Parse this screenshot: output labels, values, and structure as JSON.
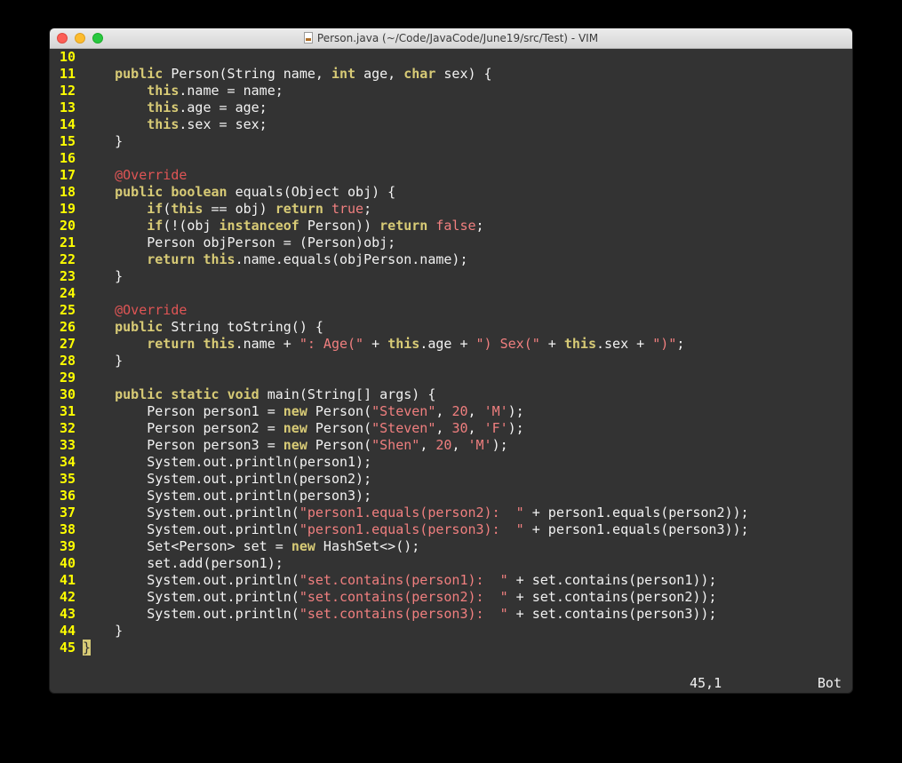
{
  "window": {
    "title": "Person.java (~/Code/JavaCode/June19/src/Test) - VIM",
    "file_icon": "java-file-icon"
  },
  "editor": {
    "lines": [
      {
        "num": "10",
        "tokens": []
      },
      {
        "num": "11",
        "tokens": [
          [
            "",
            "    "
          ],
          [
            "kw",
            "public"
          ],
          [
            "",
            " Person(String name, "
          ],
          [
            "kw",
            "int"
          ],
          [
            "",
            " age, "
          ],
          [
            "kw",
            "char"
          ],
          [
            "",
            " sex) {"
          ]
        ]
      },
      {
        "num": "12",
        "tokens": [
          [
            "",
            "        "
          ],
          [
            "kw",
            "this"
          ],
          [
            "",
            ".name = name;"
          ]
        ]
      },
      {
        "num": "13",
        "tokens": [
          [
            "",
            "        "
          ],
          [
            "kw",
            "this"
          ],
          [
            "",
            ".age = age;"
          ]
        ]
      },
      {
        "num": "14",
        "tokens": [
          [
            "",
            "        "
          ],
          [
            "kw",
            "this"
          ],
          [
            "",
            ".sex = sex;"
          ]
        ]
      },
      {
        "num": "15",
        "tokens": [
          [
            "",
            "    }"
          ]
        ]
      },
      {
        "num": "16",
        "tokens": []
      },
      {
        "num": "17",
        "tokens": [
          [
            "",
            "    "
          ],
          [
            "ann",
            "@Override"
          ]
        ]
      },
      {
        "num": "18",
        "tokens": [
          [
            "",
            "    "
          ],
          [
            "kw",
            "public"
          ],
          [
            "",
            " "
          ],
          [
            "kw",
            "boolean"
          ],
          [
            "",
            " equals(Object obj) {"
          ]
        ]
      },
      {
        "num": "19",
        "tokens": [
          [
            "",
            "        "
          ],
          [
            "kw",
            "if"
          ],
          [
            "",
            "("
          ],
          [
            "kw",
            "this"
          ],
          [
            "",
            " == obj) "
          ],
          [
            "kw",
            "return"
          ],
          [
            "",
            " "
          ],
          [
            "lit",
            "true"
          ],
          [
            "",
            ";"
          ]
        ]
      },
      {
        "num": "20",
        "tokens": [
          [
            "",
            "        "
          ],
          [
            "kw",
            "if"
          ],
          [
            "",
            "(!(obj "
          ],
          [
            "kw",
            "instanceof"
          ],
          [
            "",
            " Person)) "
          ],
          [
            "kw",
            "return"
          ],
          [
            "",
            " "
          ],
          [
            "lit",
            "false"
          ],
          [
            "",
            ";"
          ]
        ]
      },
      {
        "num": "21",
        "tokens": [
          [
            "",
            "        Person objPerson = (Person)obj;"
          ]
        ]
      },
      {
        "num": "22",
        "tokens": [
          [
            "",
            "        "
          ],
          [
            "kw",
            "return"
          ],
          [
            "",
            " "
          ],
          [
            "kw",
            "this"
          ],
          [
            "",
            ".name.equals(objPerson.name);"
          ]
        ]
      },
      {
        "num": "23",
        "tokens": [
          [
            "",
            "    }"
          ]
        ]
      },
      {
        "num": "24",
        "tokens": []
      },
      {
        "num": "25",
        "tokens": [
          [
            "",
            "    "
          ],
          [
            "ann",
            "@Override"
          ]
        ]
      },
      {
        "num": "26",
        "tokens": [
          [
            "",
            "    "
          ],
          [
            "kw",
            "public"
          ],
          [
            "",
            " String toString() {"
          ]
        ]
      },
      {
        "num": "27",
        "tokens": [
          [
            "",
            "        "
          ],
          [
            "kw",
            "return"
          ],
          [
            "",
            " "
          ],
          [
            "kw",
            "this"
          ],
          [
            "",
            ".name + "
          ],
          [
            "str",
            "\": Age(\""
          ],
          [
            "",
            " + "
          ],
          [
            "kw",
            "this"
          ],
          [
            "",
            ".age + "
          ],
          [
            "str",
            "\") Sex(\""
          ],
          [
            "",
            " + "
          ],
          [
            "kw",
            "this"
          ],
          [
            "",
            ".sex + "
          ],
          [
            "str",
            "\")\""
          ],
          [
            "",
            ";"
          ]
        ]
      },
      {
        "num": "28",
        "tokens": [
          [
            "",
            "    }"
          ]
        ]
      },
      {
        "num": "29",
        "tokens": []
      },
      {
        "num": "30",
        "tokens": [
          [
            "",
            "    "
          ],
          [
            "kw",
            "public"
          ],
          [
            "",
            " "
          ],
          [
            "kw",
            "static"
          ],
          [
            "",
            " "
          ],
          [
            "kw",
            "void"
          ],
          [
            "",
            " main(String[] args) {"
          ]
        ]
      },
      {
        "num": "31",
        "tokens": [
          [
            "",
            "        Person person1 = "
          ],
          [
            "kw",
            "new"
          ],
          [
            "",
            " Person("
          ],
          [
            "str",
            "\"Steven\""
          ],
          [
            "",
            ", "
          ],
          [
            "lit",
            "20"
          ],
          [
            "",
            ", "
          ],
          [
            "str",
            "'M'"
          ],
          [
            "",
            ");"
          ]
        ]
      },
      {
        "num": "32",
        "tokens": [
          [
            "",
            "        Person person2 = "
          ],
          [
            "kw",
            "new"
          ],
          [
            "",
            " Person("
          ],
          [
            "str",
            "\"Steven\""
          ],
          [
            "",
            ", "
          ],
          [
            "lit",
            "30"
          ],
          [
            "",
            ", "
          ],
          [
            "str",
            "'F'"
          ],
          [
            "",
            ");"
          ]
        ]
      },
      {
        "num": "33",
        "tokens": [
          [
            "",
            "        Person person3 = "
          ],
          [
            "kw",
            "new"
          ],
          [
            "",
            " Person("
          ],
          [
            "str",
            "\"Shen\""
          ],
          [
            "",
            ", "
          ],
          [
            "lit",
            "20"
          ],
          [
            "",
            ", "
          ],
          [
            "str",
            "'M'"
          ],
          [
            "",
            ");"
          ]
        ]
      },
      {
        "num": "34",
        "tokens": [
          [
            "",
            "        System.out.println(person1);"
          ]
        ]
      },
      {
        "num": "35",
        "tokens": [
          [
            "",
            "        System.out.println(person2);"
          ]
        ]
      },
      {
        "num": "36",
        "tokens": [
          [
            "",
            "        System.out.println(person3);"
          ]
        ]
      },
      {
        "num": "37",
        "tokens": [
          [
            "",
            "        System.out.println("
          ],
          [
            "str",
            "\"person1.equals(person2):  \""
          ],
          [
            "",
            " + person1.equals(person2));"
          ]
        ]
      },
      {
        "num": "38",
        "tokens": [
          [
            "",
            "        System.out.println("
          ],
          [
            "str",
            "\"person1.equals(person3):  \""
          ],
          [
            "",
            " + person1.equals(person3));"
          ]
        ]
      },
      {
        "num": "39",
        "tokens": [
          [
            "",
            "        Set<Person> set = "
          ],
          [
            "kw",
            "new"
          ],
          [
            "",
            " HashSet<>();"
          ]
        ]
      },
      {
        "num": "40",
        "tokens": [
          [
            "",
            "        set.add(person1);"
          ]
        ]
      },
      {
        "num": "41",
        "tokens": [
          [
            "",
            "        System.out.println("
          ],
          [
            "str",
            "\"set.contains(person1):  \""
          ],
          [
            "",
            " + set.contains(person1));"
          ]
        ]
      },
      {
        "num": "42",
        "tokens": [
          [
            "",
            "        System.out.println("
          ],
          [
            "str",
            "\"set.contains(person2):  \""
          ],
          [
            "",
            " + set.contains(person2));"
          ]
        ]
      },
      {
        "num": "43",
        "tokens": [
          [
            "",
            "        System.out.println("
          ],
          [
            "str",
            "\"set.contains(person3):  \""
          ],
          [
            "",
            " + set.contains(person3));"
          ]
        ]
      },
      {
        "num": "44",
        "tokens": [
          [
            "",
            "    }"
          ]
        ]
      },
      {
        "num": "45",
        "tokens": [
          [
            "cursor",
            "}"
          ]
        ]
      }
    ]
  },
  "statusbar": {
    "position": "45,1",
    "scroll": "Bot"
  },
  "colors": {
    "background": "#333333",
    "line_number": "#ffff00",
    "keyword": "#d8cb76",
    "string": "#f07f7f",
    "annotation": "#e05555",
    "text": "#f2f2f2"
  }
}
